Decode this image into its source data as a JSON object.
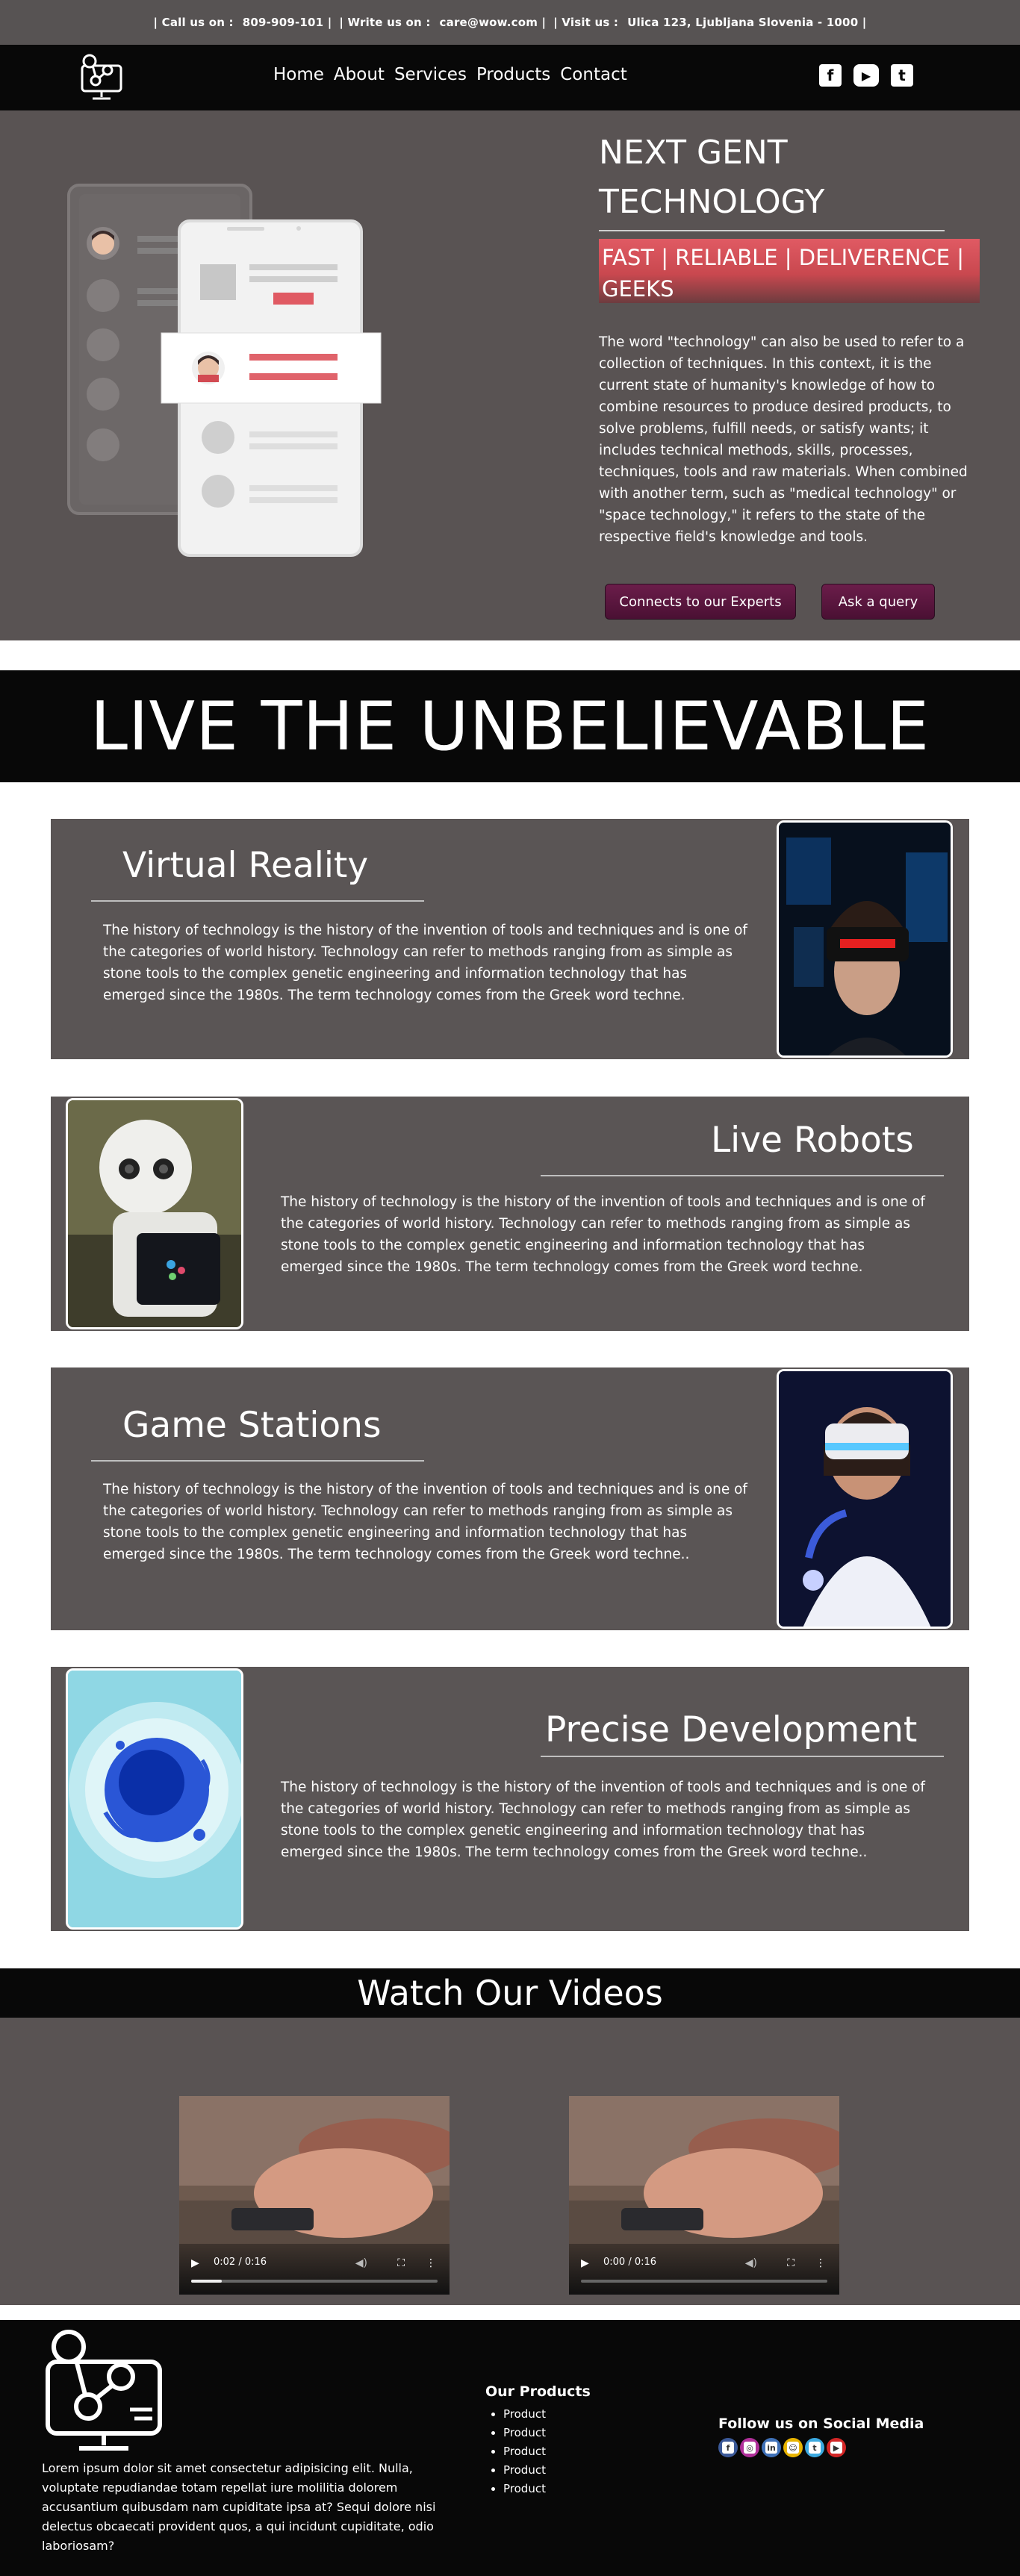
{
  "topbar": {
    "call_label": "| Call us on :",
    "phone": "809-909-101 |",
    "write_label": "| Write us on :",
    "email": "care@wow.com |",
    "visit_label": "| Visit us :",
    "address": "Ulica 123, Ljubljana Slovenia - 1000 |"
  },
  "nav": {
    "items": [
      "Home",
      "About",
      "Services",
      "Products",
      "Contact"
    ],
    "social": [
      "f",
      "▶",
      "t"
    ]
  },
  "hero": {
    "title_line1": "NEXT GENT",
    "title_line2": "TECHNOLOGY",
    "tagline_line1": "FAST | RELIABLE | DELIVERENCE |",
    "tagline_line2": "GEEKS",
    "description": "The word \"technology\" can also be used to refer to a collection of techniques. In this context, it is the current state of humanity's knowledge of how to combine resources to produce desired products, to solve problems, fulfill needs, or satisfy wants; it includes technical methods, skills, processes, techniques, tools and raw materials. When combined with another term, such as \"medical technology\" or \"space technology,\" it refers to the state of the respective field's knowledge and tools.",
    "btn_experts": "Connects to our Experts",
    "btn_query": "Ask a query"
  },
  "banner": {
    "headline": "LIVE THE UNBELIEVABLE"
  },
  "features": [
    {
      "title": "Virtual Reality",
      "text": "The history of technology is the history of the invention of tools and techniques and is one of the categories of world history. Technology can refer to methods ranging from as simple as stone tools to the complex genetic engineering and information technology that has emerged since the 1980s. The term technology comes from the Greek word techne."
    },
    {
      "title": "Live Robots",
      "text": "The history of technology is the history of the invention of tools and techniques and is one of the categories of world history. Technology can refer to methods ranging from as simple as stone tools to the complex genetic engineering and information technology that has emerged since the 1980s. The term technology comes from the Greek word techne."
    },
    {
      "title": "Game Stations",
      "text": "The history of technology is the history of the invention of tools and techniques and is one of the categories of world history. Technology can refer to methods ranging from as simple as stone tools to the complex genetic engineering and information technology that has emerged since the 1980s. The term technology comes from the Greek word techne.."
    },
    {
      "title": "Precise Development",
      "text": "The history of technology is the history of the invention of tools and techniques and is one of the categories of world history. Technology can refer to methods ranging from as simple as stone tools to the complex genetic engineering and information technology that has emerged since the 1980s. The term technology comes from the Greek word techne.."
    }
  ],
  "videos": {
    "heading": "Watch Our Videos",
    "items": [
      {
        "time": "0:02 / 0:16",
        "progress": 0.125
      },
      {
        "time": "0:00 / 0:16",
        "progress": 0.0
      }
    ]
  },
  "footer": {
    "about": "Lorem ipsum dolor sit amet consectetur adipisicing elit. Nulla, voluptate repudiandae totam repellat iure molilitia dolorem accusantium quibusdam nam cupiditate ipsa at? Sequi dolore nisi delectus obcaecati provident quos, a qui incidunt cupiditate, odio laboriosam?",
    "products_heading": "Our Products",
    "products": [
      "Product",
      "Product",
      "Product",
      "Product",
      "Product"
    ],
    "follow_heading": "Follow us on Social Media",
    "social": [
      {
        "icon": "facebook-icon",
        "glyph": "f",
        "color": "#3b5998"
      },
      {
        "icon": "instagram-icon",
        "glyph": "◎",
        "color": "#b0309a"
      },
      {
        "icon": "linkedin-icon",
        "glyph": "in",
        "color": "#3f71b8"
      },
      {
        "icon": "snapchat-icon",
        "glyph": "☺",
        "color": "#e8b400"
      },
      {
        "icon": "twitter-icon",
        "glyph": "t",
        "color": "#3ba9e0"
      },
      {
        "icon": "youtube-icon",
        "glyph": "▶",
        "color": "#d32626"
      }
    ]
  },
  "colors": {
    "dark": "#080808",
    "panel": "#595353",
    "accent_red": "#e05a63",
    "button_purple": "#6b1d4a"
  }
}
